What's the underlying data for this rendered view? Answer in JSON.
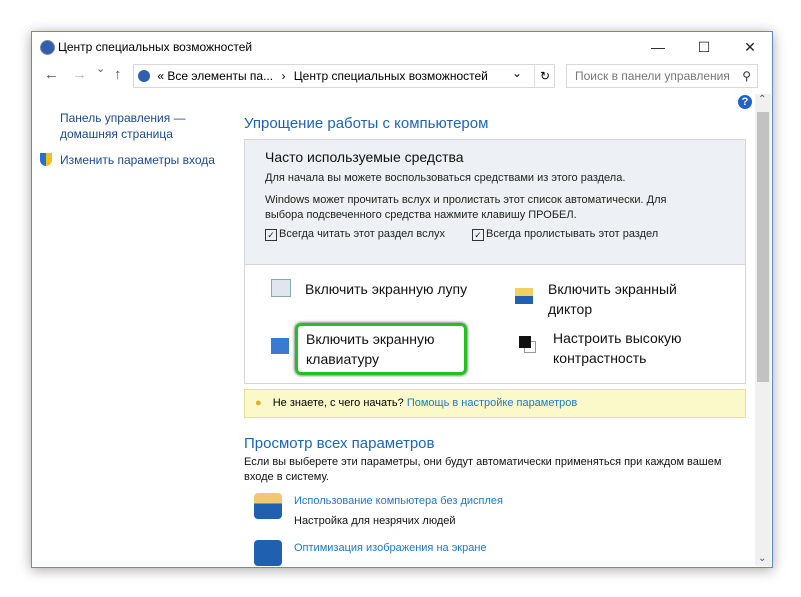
{
  "window": {
    "title": "Центр специальных возможностей",
    "minimize": "—",
    "maximize": "☐",
    "close": "✕"
  },
  "nav": {
    "back": "←",
    "forward": "→",
    "recent": "⌄",
    "up": "↑",
    "breadcrumb_prefix": "«",
    "crumb1": "Все элементы па...",
    "sep": "›",
    "crumb2": "Центр специальных возможностей",
    "dropdown": "⌄",
    "refresh": "↻",
    "search_placeholder": "Поиск в панели управления",
    "search_icon": "⚲"
  },
  "sidebar": {
    "home": "Панель управления — домашняя страница",
    "signin": "Изменить параметры входа"
  },
  "main": {
    "heading": "Упрощение работы с компьютером",
    "common": {
      "title": "Часто используемые средства",
      "line1": "Для начала вы можете воспользоваться средствами из этого раздела.",
      "line2": "Windows может прочитать вслух и пролистать этот список автоматически. Для выбора подсвеченного средства нажмите клавишу ПРОБЕЛ.",
      "check1": "Всегда читать этот раздел вслух",
      "check2": "Всегда пролистывать этот раздел",
      "check_mark": "✓"
    },
    "tools": [
      {
        "label": "Включить экранную лупу"
      },
      {
        "label": "Включить экранный диктор"
      },
      {
        "label": "Включить экранную клавиатуру"
      },
      {
        "label": "Настроить высокую контрастность"
      }
    ],
    "tip": {
      "text": "Не знаете, с чего начать?",
      "link": "Помощь в настройке параметров"
    },
    "all": {
      "title": "Просмотр всех параметров",
      "desc": "Если вы выберете эти параметры, они будут автоматически применяться при каждом вашем входе в систему.",
      "items": [
        {
          "link": "Использование компьютера без дисплея",
          "desc": "Настройка для незрячих людей"
        },
        {
          "link": "Оптимизация изображения на экране",
          "desc": ""
        }
      ]
    }
  },
  "help": "?",
  "scroll_up": "⌃",
  "scroll_down": "⌄",
  "colors": {
    "highlight": "#22c022",
    "link": "#1e78c8",
    "heading": "#1e64b4"
  }
}
